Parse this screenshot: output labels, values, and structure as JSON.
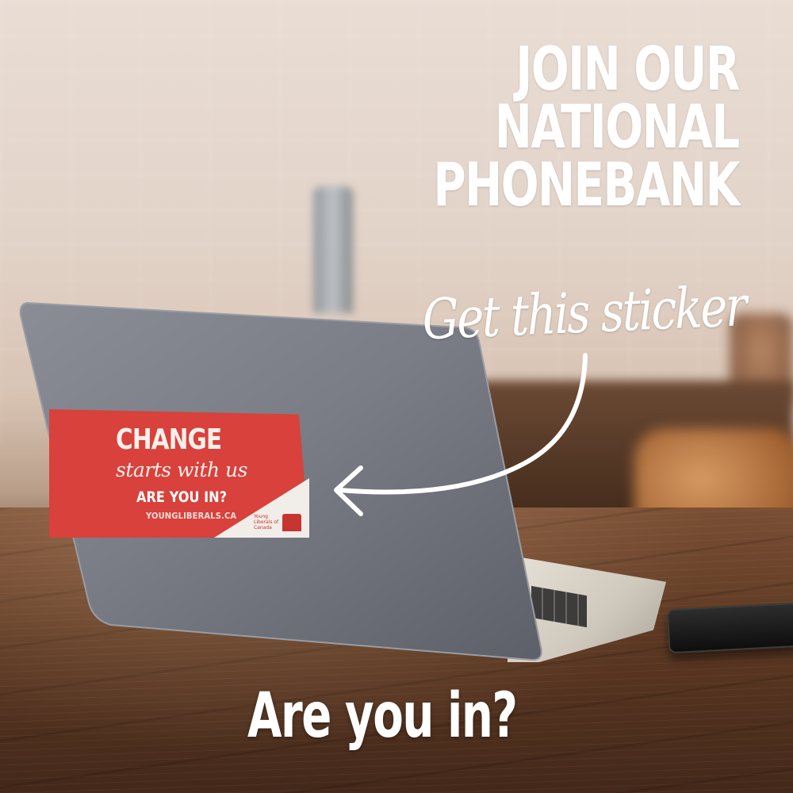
{
  "headline": {
    "line1": "JOIN OUR",
    "line2": "NATIONAL",
    "line3": "PHONEBANK"
  },
  "script_text": "Get this sticker",
  "sticker": {
    "title": "CHANGE",
    "subtitle": "starts with us",
    "question": "ARE YOU IN?",
    "url": "YOUNGLIBERALS.CA",
    "logo_text": "Young Liberals of Canada"
  },
  "call_to_action": "Are you in?",
  "colors": {
    "sticker_red": "#d8413c",
    "text_white": "#ffffff"
  }
}
